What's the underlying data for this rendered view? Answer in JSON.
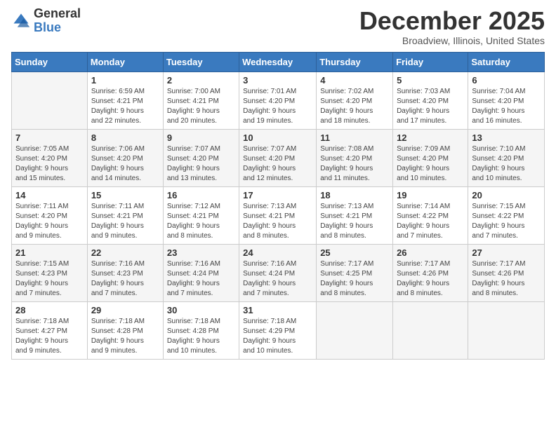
{
  "logo": {
    "general": "General",
    "blue": "Blue"
  },
  "title": "December 2025",
  "location": "Broadview, Illinois, United States",
  "days_of_week": [
    "Sunday",
    "Monday",
    "Tuesday",
    "Wednesday",
    "Thursday",
    "Friday",
    "Saturday"
  ],
  "weeks": [
    [
      {
        "day": "",
        "info": ""
      },
      {
        "day": "1",
        "info": "Sunrise: 6:59 AM\nSunset: 4:21 PM\nDaylight: 9 hours\nand 22 minutes."
      },
      {
        "day": "2",
        "info": "Sunrise: 7:00 AM\nSunset: 4:21 PM\nDaylight: 9 hours\nand 20 minutes."
      },
      {
        "day": "3",
        "info": "Sunrise: 7:01 AM\nSunset: 4:20 PM\nDaylight: 9 hours\nand 19 minutes."
      },
      {
        "day": "4",
        "info": "Sunrise: 7:02 AM\nSunset: 4:20 PM\nDaylight: 9 hours\nand 18 minutes."
      },
      {
        "day": "5",
        "info": "Sunrise: 7:03 AM\nSunset: 4:20 PM\nDaylight: 9 hours\nand 17 minutes."
      },
      {
        "day": "6",
        "info": "Sunrise: 7:04 AM\nSunset: 4:20 PM\nDaylight: 9 hours\nand 16 minutes."
      }
    ],
    [
      {
        "day": "7",
        "info": "Sunrise: 7:05 AM\nSunset: 4:20 PM\nDaylight: 9 hours\nand 15 minutes."
      },
      {
        "day": "8",
        "info": "Sunrise: 7:06 AM\nSunset: 4:20 PM\nDaylight: 9 hours\nand 14 minutes."
      },
      {
        "day": "9",
        "info": "Sunrise: 7:07 AM\nSunset: 4:20 PM\nDaylight: 9 hours\nand 13 minutes."
      },
      {
        "day": "10",
        "info": "Sunrise: 7:07 AM\nSunset: 4:20 PM\nDaylight: 9 hours\nand 12 minutes."
      },
      {
        "day": "11",
        "info": "Sunrise: 7:08 AM\nSunset: 4:20 PM\nDaylight: 9 hours\nand 11 minutes."
      },
      {
        "day": "12",
        "info": "Sunrise: 7:09 AM\nSunset: 4:20 PM\nDaylight: 9 hours\nand 10 minutes."
      },
      {
        "day": "13",
        "info": "Sunrise: 7:10 AM\nSunset: 4:20 PM\nDaylight: 9 hours\nand 10 minutes."
      }
    ],
    [
      {
        "day": "14",
        "info": "Sunrise: 7:11 AM\nSunset: 4:20 PM\nDaylight: 9 hours\nand 9 minutes."
      },
      {
        "day": "15",
        "info": "Sunrise: 7:11 AM\nSunset: 4:21 PM\nDaylight: 9 hours\nand 9 minutes."
      },
      {
        "day": "16",
        "info": "Sunrise: 7:12 AM\nSunset: 4:21 PM\nDaylight: 9 hours\nand 8 minutes."
      },
      {
        "day": "17",
        "info": "Sunrise: 7:13 AM\nSunset: 4:21 PM\nDaylight: 9 hours\nand 8 minutes."
      },
      {
        "day": "18",
        "info": "Sunrise: 7:13 AM\nSunset: 4:21 PM\nDaylight: 9 hours\nand 8 minutes."
      },
      {
        "day": "19",
        "info": "Sunrise: 7:14 AM\nSunset: 4:22 PM\nDaylight: 9 hours\nand 7 minutes."
      },
      {
        "day": "20",
        "info": "Sunrise: 7:15 AM\nSunset: 4:22 PM\nDaylight: 9 hours\nand 7 minutes."
      }
    ],
    [
      {
        "day": "21",
        "info": "Sunrise: 7:15 AM\nSunset: 4:23 PM\nDaylight: 9 hours\nand 7 minutes."
      },
      {
        "day": "22",
        "info": "Sunrise: 7:16 AM\nSunset: 4:23 PM\nDaylight: 9 hours\nand 7 minutes."
      },
      {
        "day": "23",
        "info": "Sunrise: 7:16 AM\nSunset: 4:24 PM\nDaylight: 9 hours\nand 7 minutes."
      },
      {
        "day": "24",
        "info": "Sunrise: 7:16 AM\nSunset: 4:24 PM\nDaylight: 9 hours\nand 7 minutes."
      },
      {
        "day": "25",
        "info": "Sunrise: 7:17 AM\nSunset: 4:25 PM\nDaylight: 9 hours\nand 8 minutes."
      },
      {
        "day": "26",
        "info": "Sunrise: 7:17 AM\nSunset: 4:26 PM\nDaylight: 9 hours\nand 8 minutes."
      },
      {
        "day": "27",
        "info": "Sunrise: 7:17 AM\nSunset: 4:26 PM\nDaylight: 9 hours\nand 8 minutes."
      }
    ],
    [
      {
        "day": "28",
        "info": "Sunrise: 7:18 AM\nSunset: 4:27 PM\nDaylight: 9 hours\nand 9 minutes."
      },
      {
        "day": "29",
        "info": "Sunrise: 7:18 AM\nSunset: 4:28 PM\nDaylight: 9 hours\nand 9 minutes."
      },
      {
        "day": "30",
        "info": "Sunrise: 7:18 AM\nSunset: 4:28 PM\nDaylight: 9 hours\nand 10 minutes."
      },
      {
        "day": "31",
        "info": "Sunrise: 7:18 AM\nSunset: 4:29 PM\nDaylight: 9 hours\nand 10 minutes."
      },
      {
        "day": "",
        "info": ""
      },
      {
        "day": "",
        "info": ""
      },
      {
        "day": "",
        "info": ""
      }
    ]
  ],
  "row_shades": [
    false,
    true,
    false,
    true,
    false
  ]
}
